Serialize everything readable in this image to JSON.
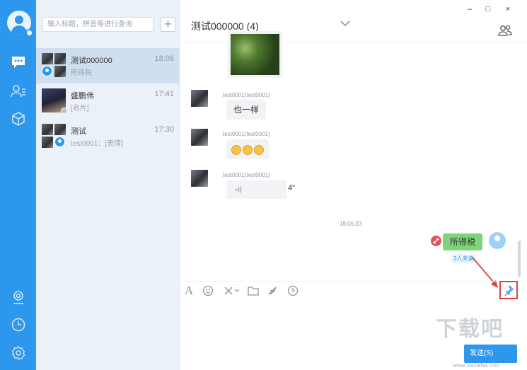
{
  "colors": {
    "accent": "#2d97ee",
    "self_bubble": "#7fd37b",
    "selected_row": "#cfdff0",
    "highlight": "#e0413f"
  },
  "rail": {
    "icons": [
      "user-avatar-icon",
      "chat-icon",
      "contacts-icon",
      "apps-cube-icon",
      "profile-icon",
      "clock-icon",
      "settings-icon"
    ]
  },
  "search": {
    "placeholder": "输入标题，拼音等进行查询"
  },
  "add_button": "+",
  "conversations": [
    {
      "name": "测试000000",
      "time": "18:06",
      "preview": "所得税"
    },
    {
      "name": "盛鹏伟",
      "time": "17:41",
      "preview": "[名片]"
    },
    {
      "name": "测试",
      "time": "17:30",
      "preview": "test0001：[表情]"
    }
  ],
  "window": {
    "minimize": "–",
    "maximize": "□",
    "close": "×"
  },
  "chat": {
    "title": "测试000000 (4)",
    "messages": [
      {
        "sender": "test0001(test0001)",
        "text": "也一样"
      },
      {
        "sender": "test0001(test0001)",
        "text": ""
      },
      {
        "sender": "test0001(test0001)",
        "voice_length": "4\""
      }
    ],
    "timestamp": "18:06:33",
    "my_message": "所得税",
    "unread": "3人未读"
  },
  "send_button": "发送(S)",
  "watermark": "下载吧",
  "watermark_url": "www.xiazaiba.com"
}
